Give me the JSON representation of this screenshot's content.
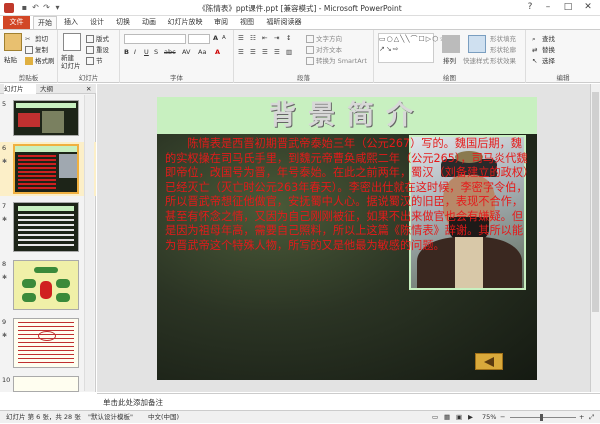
{
  "window": {
    "title": "《陈情表》ppt课件.ppt [兼容模式] - Microsoft PowerPoint"
  },
  "tabs": [
    "文件",
    "开始",
    "插入",
    "设计",
    "切换",
    "动画",
    "幻灯片放映",
    "审阅",
    "视图",
    "福昕阅读器"
  ],
  "ribbon": {
    "paste": "粘贴",
    "cut": "剪切",
    "copy": "复制",
    "format_painter": "格式刷",
    "clipboard": "剪贴板",
    "new_slide": "新建\n幻灯片",
    "layout": "版式",
    "reset": "重设",
    "section": "节",
    "slides": "幻灯片",
    "font": "字体",
    "paragraph": "段落",
    "text_direction": "文字方向",
    "align_text": "对齐文本",
    "smartart": "转换为 SmartArt",
    "arrange": "排列",
    "quick_styles": "快速样式",
    "shape_fill": "形状填充",
    "shape_outline": "形状轮廓",
    "shape_effects": "形状效果",
    "drawing": "绘图",
    "find": "查找",
    "replace": "替换",
    "select": "选择",
    "editing": "编辑"
  },
  "left_pane": {
    "tab_slides": "幻灯片",
    "tab_outline": "大纲",
    "slide_numbers": [
      "5",
      "6",
      "7",
      "8",
      "9",
      "10"
    ]
  },
  "slide": {
    "title": "背景简介",
    "body": "陈情表是西晋初期晋武帝泰始三年（公元267）写的。魏国后期，魏的实权操在司马氏手里，到魏元帝曹奂咸熙二年（公元265），司马炎代魏即帝位，改国号为晋，年号泰始。在此之前两年，蜀汉（刘备建立的政权）已经灭亡（灭亡时公元263年春天）。李密出仕就在这时候，李密字令伯，所以晋武帝想征他做官，安抚蜀中人心。据说蜀汉的旧臣，表现不合作，甚至有怀念之情，又因为自己刚刚被征，如果不出来做官也会有嫌疑。但是因为祖母年高，需要自己照料，所以上这篇《陈情表》辞谢。其所以能为晋武帝这个特殊人物，所写的又是他最为敏感的问题。"
  },
  "notes": {
    "placeholder": "单击此处添加备注"
  },
  "status": {
    "slide_info": "幻灯片 第 6 张，共 28 张",
    "theme": "\"默认设计模板\"",
    "language": "中文(中国)",
    "zoom": "75%"
  }
}
